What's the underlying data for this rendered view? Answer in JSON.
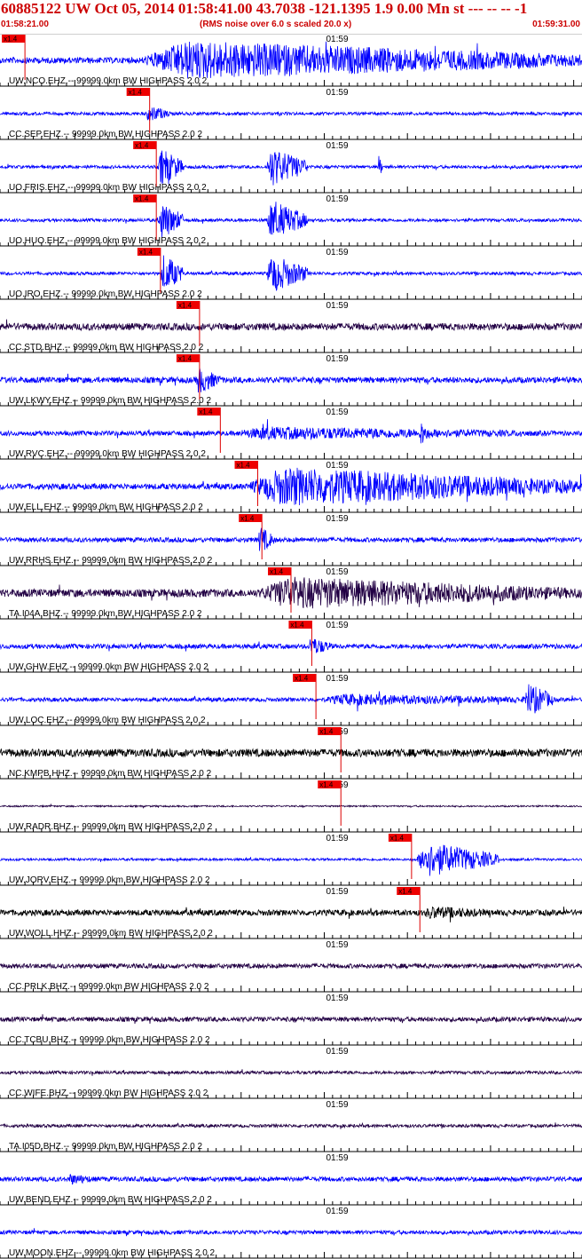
{
  "header": {
    "title": "60885122 UW Oct 05, 2014 01:58:41.00   43.7038 -121.1395  1.9 0.00 Mn st --- -- --   -1",
    "start_time": "01:58:21.00",
    "end_time": "01:59:31.00",
    "noise_note": "(RMS noise over 6.0 s scaled 20.0 x)",
    "minute_label": "01:59",
    "pick_label": "x1.4"
  },
  "colors": {
    "header_text": "#cc0000",
    "trace_blue": "#0000ff",
    "trace_purple": "#220044",
    "trace_black": "#000000",
    "pick_line": "#dd0000",
    "pick_box": "#ee0000",
    "axis": "#000000"
  },
  "chart_data": {
    "type": "line",
    "x_unit": "time",
    "xlim": [
      "01:58:21.00",
      "01:59:31.00"
    ],
    "series": [
      {
        "name": "UW.NCO.EHZ.-- 99999.0km BW  HIGHPASS  2.0  2",
        "color": "blue",
        "pick": "01:58:24.0",
        "events": [
          {
            "start": "01:58:37.0",
            "end": "01:59:31.0",
            "amp": 1.0
          }
        ],
        "noise": 0.15
      },
      {
        "name": "CC.SEP.EHZ.-- 99999.0km BW  HIGHPASS  2.0  2",
        "color": "blue",
        "pick": "01:58:39.0",
        "events": [
          {
            "start": "01:58:38.5",
            "end": "01:58:41.5",
            "amp": 0.45
          }
        ],
        "noise": 0.08
      },
      {
        "name": "UO.FRIS.EHZ.-- 99999.0km BW  HIGHPASS  2.0  2",
        "color": "blue",
        "pick": "01:58:39.8",
        "events": [
          {
            "start": "01:58:40.0",
            "end": "01:58:43.0",
            "amp": 1.0
          },
          {
            "start": "01:58:53.0",
            "end": "01:58:58.0",
            "amp": 1.0
          },
          {
            "start": "01:59:06.5",
            "end": "01:59:07.0",
            "amp": 0.6
          }
        ],
        "noise": 0.08
      },
      {
        "name": "UO.HUO.EHZ.-- 99999.0km BW  HIGHPASS  2.0  2",
        "color": "blue",
        "pick": "01:58:39.8",
        "events": [
          {
            "start": "01:58:40.0",
            "end": "01:58:43.0",
            "amp": 1.0
          },
          {
            "start": "01:58:53.0",
            "end": "01:58:58.0",
            "amp": 1.0
          }
        ],
        "noise": 0.08
      },
      {
        "name": "UO.IRO.EHZ.-- 99999.0km BW  HIGHPASS  2.0  2",
        "color": "blue",
        "pick": "01:58:40.3",
        "events": [
          {
            "start": "01:58:40.3",
            "end": "01:58:43.0",
            "amp": 1.0
          },
          {
            "start": "01:58:53.0",
            "end": "01:58:58.0",
            "amp": 1.0
          }
        ],
        "noise": 0.08
      },
      {
        "name": "CC.STD.BHZ.-- 99999.0km BW  HIGHPASS  2.0  2",
        "color": "purple",
        "pick": "01:58:45.0",
        "events": [],
        "noise": 0.18
      },
      {
        "name": "UW.LKWY.EHZ.-- 99999.0km BW  HIGHPASS  2.0  2",
        "color": "blue",
        "pick": "01:58:45.0",
        "events": [
          {
            "start": "01:58:44.5",
            "end": "01:58:47.5",
            "amp": 0.7
          }
        ],
        "noise": 0.15
      },
      {
        "name": "UW.RVC.EHZ.-- 99999.0km BW  HIGHPASS  2.0  2",
        "color": "blue",
        "pick": "01:58:47.5",
        "events": [
          {
            "start": "01:58:47.5",
            "end": "01:59:31.0",
            "amp": 0.35
          },
          {
            "start": "01:59:11.5",
            "end": "01:59:12.5",
            "amp": 0.7
          }
        ],
        "noise": 0.12
      },
      {
        "name": "UW.ELL.EHZ.-- 99999.0km BW  HIGHPASS  2.0  2",
        "color": "blue",
        "pick": "01:58:52.0",
        "events": [
          {
            "start": "01:58:50.0",
            "end": "01:59:31.0",
            "amp": 1.0
          }
        ],
        "noise": 0.15
      },
      {
        "name": "UW.RRHS.EHZ.-- 99999.0km BW  HIGHPASS  2.0  2",
        "color": "blue",
        "pick": "01:58:52.5",
        "events": [
          {
            "start": "01:58:52.0",
            "end": "01:58:54.0",
            "amp": 0.7
          }
        ],
        "noise": 0.12
      },
      {
        "name": "TA.I04A.BHZ.-- 99999.0km BW  HIGHPASS  2.0  2",
        "color": "purple",
        "pick": "01:58:56.0",
        "events": [
          {
            "start": "01:58:51.0",
            "end": "01:59:31.0",
            "amp": 0.85
          }
        ],
        "noise": 0.2
      },
      {
        "name": "UW.GHW.EHZ.-- 99999.0km BW  HIGHPASS  2.0  2",
        "color": "blue",
        "pick": "01:58:58.5",
        "events": [
          {
            "start": "01:58:58.0",
            "end": "01:59:01.0",
            "amp": 0.5
          }
        ],
        "noise": 0.12
      },
      {
        "name": "UW.LOC.EHZ.-- 99999.0km BW  HIGHPASS  2.0  2",
        "color": "blue",
        "pick": "01:58:59.0",
        "events": [
          {
            "start": "01:58:58.5",
            "end": "01:59:31.0",
            "amp": 0.3
          },
          {
            "start": "01:59:24.0",
            "end": "01:59:27.5",
            "amp": 0.9
          }
        ],
        "noise": 0.1
      },
      {
        "name": "NC.KMPB.HHZ.-- 99999.0km BW  HIGHPASS  2.0  2",
        "color": "black",
        "pick": "01:59:02.0",
        "events": [],
        "noise": 0.2
      },
      {
        "name": "UW.RADR.BHZ.-- 99999.0km BW  HIGHPASS  2.0  2",
        "color": "purple",
        "pick": "01:59:02.0",
        "events": [],
        "noise": 0.04
      },
      {
        "name": "UW.JORV.EHZ.-- 99999.0km BW  HIGHPASS  2.0  2",
        "color": "blue",
        "pick": "01:59:10.5",
        "events": [
          {
            "start": "01:59:11.0",
            "end": "01:59:21.0",
            "amp": 0.9
          }
        ],
        "noise": 0.06
      },
      {
        "name": "UW.WOLL.HHZ.-- 99999.0km BW  HIGHPASS  2.0  2",
        "color": "black",
        "pick": "01:59:11.5",
        "events": [
          {
            "start": "01:59:11.5",
            "end": "01:59:22.0",
            "amp": 0.35
          }
        ],
        "noise": 0.15
      },
      {
        "name": "CC.PRLK.BHZ.-- 99999.0km BW  HIGHPASS  2.0  2",
        "color": "purple",
        "events": [],
        "noise": 0.12
      },
      {
        "name": "CC.TCBU.BHZ.-- 99999.0km BW  HIGHPASS  2.0  2",
        "color": "purple",
        "events": [],
        "noise": 0.12
      },
      {
        "name": "CC.WIFE.BHZ.-- 99999.0km BW  HIGHPASS  2.0  2",
        "color": "purple",
        "events": [],
        "noise": 0.08
      },
      {
        "name": "TA.I05D.BHZ.-- 99999.0km BW  HIGHPASS  2.0  2",
        "color": "purple",
        "events": [],
        "noise": 0.08
      },
      {
        "name": "UW.BEND.EHZ.-- 99999.0km BW  HIGHPASS  2.0  2",
        "color": "blue",
        "events": [
          {
            "start": "01:58:29.0",
            "end": "01:58:33.0",
            "amp": 0.3
          }
        ],
        "noise": 0.12
      },
      {
        "name": "UW.MOON.EHZ.-- 99999.0km BW  HIGHPASS  2.0  2",
        "color": "blue",
        "events": [],
        "noise": 0.1
      }
    ]
  }
}
